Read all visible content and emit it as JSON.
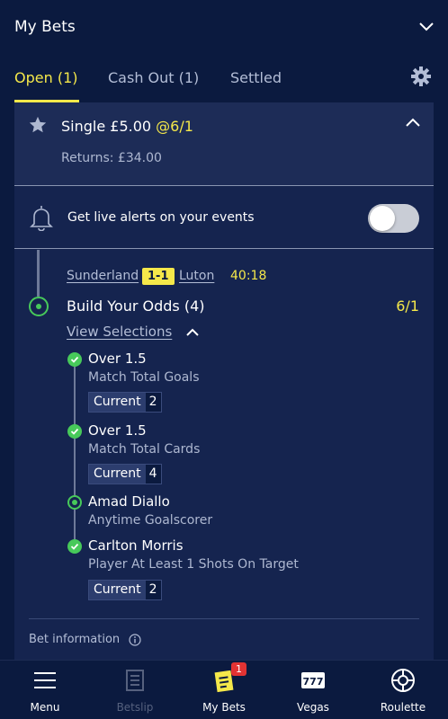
{
  "header": {
    "title": "My Bets"
  },
  "tabs": [
    {
      "label": "Open (1)"
    },
    {
      "label": "Cash Out (1)"
    },
    {
      "label": "Settled"
    }
  ],
  "bet": {
    "title": "Single £5.00",
    "odds": "@6/1",
    "returns": "Returns: £34.00"
  },
  "alerts": {
    "text": "Get live alerts on your events",
    "enabled": false
  },
  "match": {
    "home": "Sunderland",
    "score": "1-1",
    "away": "Luton",
    "clock": "40:18"
  },
  "build_your_odds": {
    "title": "Build Your Odds (4)",
    "odds": "6/1",
    "view_selections": "View Selections"
  },
  "selections": [
    {
      "title": "Over 1.5",
      "market": "Match Total Goals",
      "current_label": "Current",
      "current_value": "2",
      "status": "won"
    },
    {
      "title": "Over 1.5",
      "market": "Match Total Cards",
      "current_label": "Current",
      "current_value": "4",
      "status": "won"
    },
    {
      "title": "Amad Diallo",
      "market": "Anytime Goalscorer",
      "status": "open"
    },
    {
      "title": "Carlton Morris",
      "market": "Player At Least 1 Shots On Target",
      "current_label": "Current",
      "current_value": "2",
      "status": "won"
    }
  ],
  "bet_information": "Bet information",
  "nav": {
    "menu": "Menu",
    "betslip": "Betslip",
    "mybets": "My Bets",
    "mybets_badge": "1",
    "vegas": "Vegas",
    "roulette": "Roulette"
  },
  "colors": {
    "background": "#0b1a3f",
    "accent": "#f5e84a",
    "success": "#47c95a",
    "badge": "#e23333"
  }
}
